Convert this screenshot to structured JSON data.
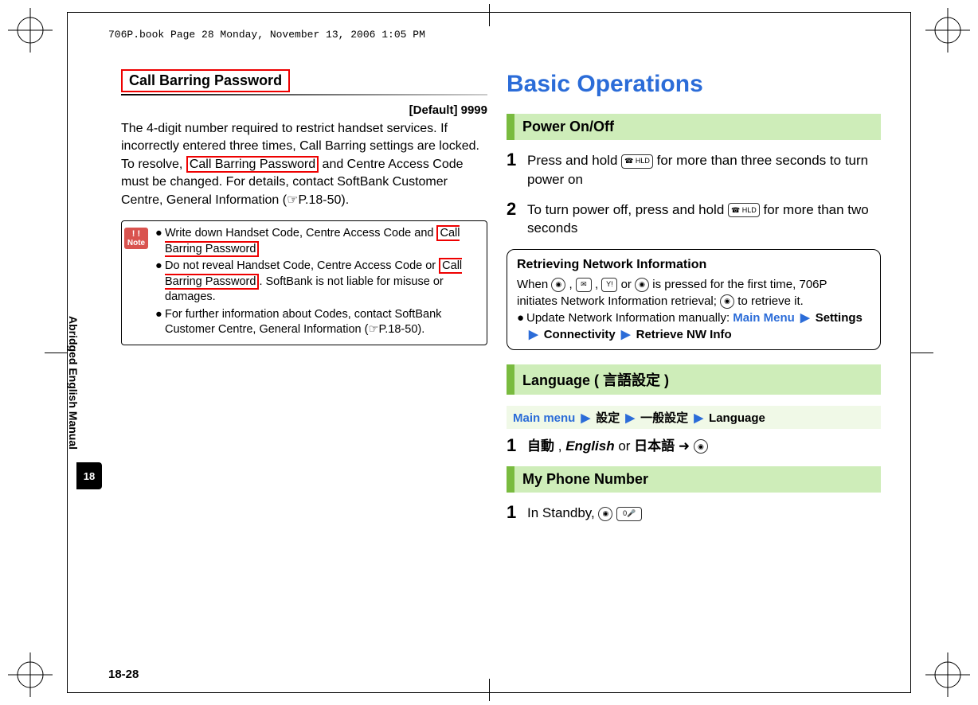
{
  "print_header": "706P.book  Page 28  Monday, November 13, 2006  1:05 PM",
  "side": {
    "vertical_label": "Abridged English Manual",
    "chapter_tab": "18"
  },
  "page_number": "18-28",
  "left": {
    "heading": "Call Barring Password",
    "default_label": "[Default] 9999",
    "body_pre": "The 4-digit number required to restrict handset services. If incorrectly entered three times, Call Barring settings are locked. To resolve, ",
    "body_redbox": "Call Barring Password",
    "body_post": " and Centre Access Code must be changed. For details, contact SoftBank Customer Centre, General Information (☞P.18-50).",
    "note_label_bang": "! !",
    "note_label": "Note",
    "note": {
      "b1_pre": "Write down Handset Code, Centre Access Code and ",
      "b1_red": "Call Barring Password",
      "b2_pre": "Do not reveal Handset Code, Centre Access Code or ",
      "b2_red": "Call Barring Password",
      "b2_post": ". SoftBank is not liable for misuse or damages.",
      "b3": "For further information about Codes, contact SoftBank Customer Centre, General Information (☞P.18-50)."
    }
  },
  "right": {
    "main_title": "Basic Operations",
    "power_heading": "Power On/Off",
    "power_step1_a": "Press and hold ",
    "power_step1_b": " for more than three seconds to turn power on",
    "power_step2_a": "To turn power off, press and hold ",
    "power_step2_b": " for more than two seconds",
    "info": {
      "title": "Retrieving Network Information",
      "line1_a": "When ",
      "line1_b": ", ",
      "line1_c": ", ",
      "line1_d": " or ",
      "line1_e": " is pressed for the first time, 706P initiates Network Information retrieval; ",
      "line1_f": " to retrieve it.",
      "line2_a": "Update Network Information manually: ",
      "mm": "Main Menu",
      "settings": "Settings",
      "connectivity": "Connectivity",
      "retrieve": "Retrieve NW Info"
    },
    "lang_heading": "Language ( 言語設定 )",
    "path": {
      "p1": "Main menu",
      "p2": "設定",
      "p3": "一般設定",
      "p4": "Language"
    },
    "lang_step": {
      "opt1": "自動",
      "sep1": " , ",
      "opt2": "English",
      "sep2": " or ",
      "opt3": "日本語",
      "arrow_sym": " ➜ "
    },
    "phone_heading": "My Phone Number",
    "phone_step_a": "In Standby, ",
    "key_zero": "0"
  },
  "icons": {
    "power": "☎ HLD",
    "center_dot": "●",
    "mail": "✉",
    "yahoo": "Y!",
    "key4": "⬤"
  }
}
